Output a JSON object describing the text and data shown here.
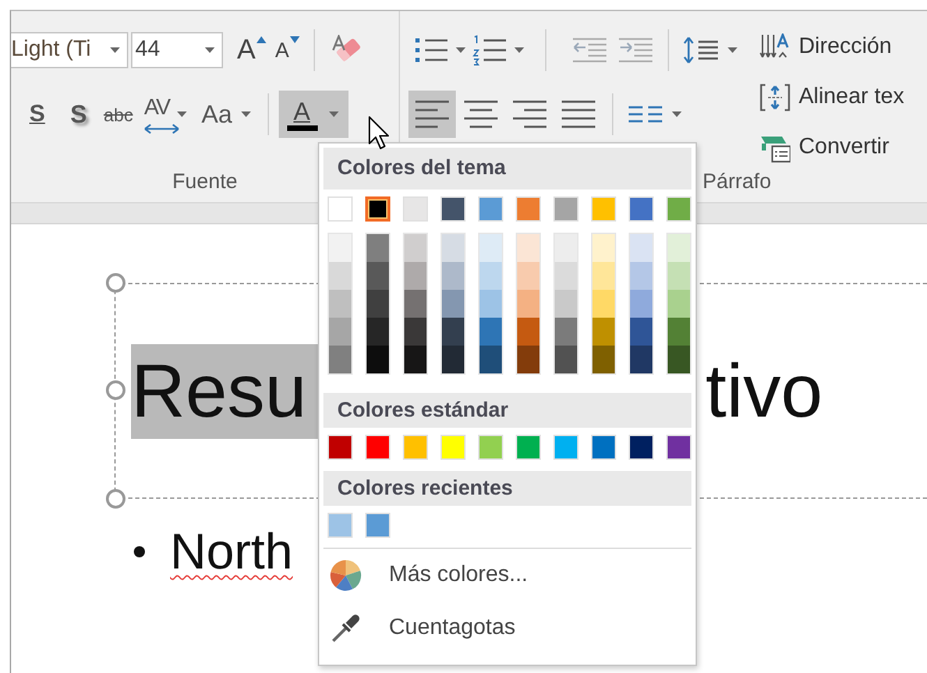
{
  "ribbon": {
    "font_group": {
      "label": "Fuente",
      "font_name": "Light (Ti",
      "font_size": "44",
      "size_buttons": [
        {
          "kind": "grow",
          "label": "A"
        },
        {
          "kind": "shrink",
          "label": "A"
        }
      ],
      "format_buttons": [
        {
          "kind": "underline",
          "label": "S"
        },
        {
          "kind": "shadow",
          "label": "S"
        },
        {
          "kind": "strikethrough",
          "label": "abc"
        },
        {
          "kind": "spacing",
          "label": "AV"
        },
        {
          "kind": "case",
          "label": "Aa"
        }
      ],
      "font_color_button": {
        "label": "A",
        "pressed": true
      }
    },
    "paragraph_group": {
      "label": "Párrafo",
      "align_buttons": [
        {
          "kind": "left",
          "selected": true
        },
        {
          "kind": "center",
          "selected": false
        },
        {
          "kind": "right",
          "selected": false
        },
        {
          "kind": "justify",
          "selected": false
        }
      ],
      "commands": [
        {
          "kind": "direction",
          "label": "Dirección"
        },
        {
          "kind": "align",
          "label": "Alinear tex"
        },
        {
          "kind": "convert",
          "label": "Convertir"
        }
      ]
    }
  },
  "slide": {
    "title_parts": [
      {
        "text": "Resu",
        "highlighted": true
      },
      {
        "text": "tivo",
        "highlighted": false
      }
    ],
    "bullets": [
      {
        "text": "North",
        "spelling_error": true
      }
    ]
  },
  "color_menu": {
    "sections": [
      {
        "kind": "theme",
        "title": "Colores del tema",
        "swatches": [
          {
            "color": "#ffffff",
            "selected": false
          },
          {
            "color": "#000000",
            "selected": true
          },
          {
            "color": "#e7e6e6",
            "selected": false
          },
          {
            "color": "#44546a",
            "selected": false
          },
          {
            "color": "#5b9bd5",
            "selected": false
          },
          {
            "color": "#ed7d31",
            "selected": false
          },
          {
            "color": "#a5a5a5",
            "selected": false
          },
          {
            "color": "#ffc000",
            "selected": false
          },
          {
            "color": "#4472c4",
            "selected": false
          },
          {
            "color": "#70ad47",
            "selected": false
          }
        ],
        "shade_columns": [
          {
            "shades": [
              {
                "color": "#f2f2f2"
              },
              {
                "color": "#d9d9d9"
              },
              {
                "color": "#bfbfbf"
              },
              {
                "color": "#a6a6a6"
              },
              {
                "color": "#808080"
              }
            ]
          },
          {
            "shades": [
              {
                "color": "#7f7f7f"
              },
              {
                "color": "#595959"
              },
              {
                "color": "#404040"
              },
              {
                "color": "#262626"
              },
              {
                "color": "#0d0d0d"
              }
            ]
          },
          {
            "shades": [
              {
                "color": "#d0cece"
              },
              {
                "color": "#aeaaaa"
              },
              {
                "color": "#757171"
              },
              {
                "color": "#3a3838"
              },
              {
                "color": "#171616"
              }
            ]
          },
          {
            "shades": [
              {
                "color": "#d6dce4"
              },
              {
                "color": "#adb9ca"
              },
              {
                "color": "#8497b0"
              },
              {
                "color": "#333f4f"
              },
              {
                "color": "#222a35"
              }
            ]
          },
          {
            "shades": [
              {
                "color": "#deebf6"
              },
              {
                "color": "#bdd7ee"
              },
              {
                "color": "#9dc3e6"
              },
              {
                "color": "#2e75b5"
              },
              {
                "color": "#1f4e79"
              }
            ]
          },
          {
            "shades": [
              {
                "color": "#fbe5d5"
              },
              {
                "color": "#f8cbad"
              },
              {
                "color": "#f4b183"
              },
              {
                "color": "#c55a11"
              },
              {
                "color": "#833c0b"
              }
            ]
          },
          {
            "shades": [
              {
                "color": "#ededed"
              },
              {
                "color": "#dbdbdb"
              },
              {
                "color": "#c9c9c9"
              },
              {
                "color": "#7b7b7b"
              },
              {
                "color": "#525252"
              }
            ]
          },
          {
            "shades": [
              {
                "color": "#fff2cc"
              },
              {
                "color": "#ffe699"
              },
              {
                "color": "#ffd966"
              },
              {
                "color": "#bf9000"
              },
              {
                "color": "#7f6000"
              }
            ]
          },
          {
            "shades": [
              {
                "color": "#dae3f3"
              },
              {
                "color": "#b4c7e7"
              },
              {
                "color": "#8faadc"
              },
              {
                "color": "#2f5597"
              },
              {
                "color": "#203864"
              }
            ]
          },
          {
            "shades": [
              {
                "color": "#e2f0d9"
              },
              {
                "color": "#c5e0b4"
              },
              {
                "color": "#a9d18e"
              },
              {
                "color": "#538135"
              },
              {
                "color": "#385723"
              }
            ]
          }
        ]
      },
      {
        "kind": "standard",
        "title": "Colores estándar",
        "swatches": [
          {
            "color": "#c00000",
            "selected": false
          },
          {
            "color": "#ff0000",
            "selected": false
          },
          {
            "color": "#ffc000",
            "selected": false
          },
          {
            "color": "#ffff00",
            "selected": false
          },
          {
            "color": "#92d050",
            "selected": false
          },
          {
            "color": "#00b050",
            "selected": false
          },
          {
            "color": "#00b0f0",
            "selected": false
          },
          {
            "color": "#0070c0",
            "selected": false
          },
          {
            "color": "#002060",
            "selected": false
          },
          {
            "color": "#7030a0",
            "selected": false
          }
        ]
      },
      {
        "kind": "recent",
        "title": "Colores recientes",
        "swatches": [
          {
            "color": "#9dc3e6",
            "selected": false
          },
          {
            "color": "#5b9bd5",
            "selected": false
          }
        ]
      }
    ],
    "commands": [
      {
        "kind": "more_colors",
        "label": "Más colores..."
      },
      {
        "kind": "eyedropper",
        "label": "Cuentagotas"
      }
    ]
  }
}
